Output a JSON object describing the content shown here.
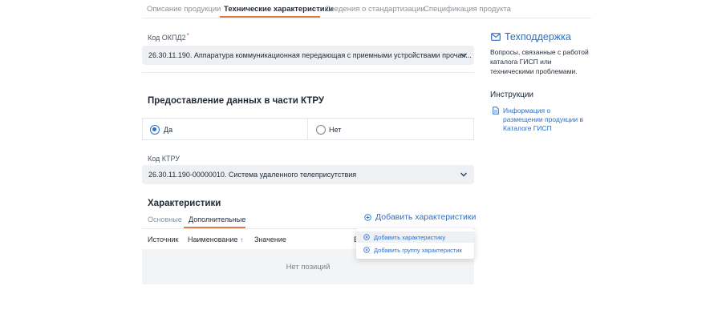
{
  "tabs": [
    {
      "label": "Описание продукции",
      "active": false
    },
    {
      "label": "Технические характеристики",
      "active": true
    },
    {
      "label": "Сведения о стандартизации",
      "active": false
    },
    {
      "label": "Спецификация продукта",
      "active": false
    }
  ],
  "okpd": {
    "label": "Код ОКПД2",
    "required_mark": "*",
    "value": "26.30.11.190. Аппаратура коммуникационная передающая с приемными устройствами прочая..."
  },
  "ktru_section": {
    "title": "Предоставление данных в части КТРУ",
    "options": [
      {
        "label": "Да",
        "checked": true
      },
      {
        "label": "Нет",
        "checked": false
      }
    ],
    "code_label": "Код КТРУ",
    "code_value": "26.30.11.190-00000010. Система удаленного телеприсутствия"
  },
  "characteristics": {
    "title": "Характеристики",
    "subtabs": [
      {
        "label": "Основные",
        "active": false
      },
      {
        "label": "Дополнительные",
        "active": true
      }
    ],
    "add_button": "Добавить характеристики",
    "columns": [
      "Источник",
      "Наименование",
      "Значение",
      "Е"
    ],
    "sort_indicator": "↑",
    "empty_text": "Нет позиций",
    "dropdown_items": [
      "Добавить характеристику",
      "Добавить группу характеристик"
    ]
  },
  "sidebar": {
    "support_title": "Техподдержка",
    "support_text": "Вопросы, связанные с работой каталога ГИСП или техническими проблемами.",
    "instructions_title": "Инструкции",
    "instruction_link": "Информация о размещении продукции в Каталоге ГИСП"
  },
  "colors": {
    "accent": "#2b6fc7",
    "tab_underline": "#e07a46",
    "field_bg": "#eef0f3"
  }
}
